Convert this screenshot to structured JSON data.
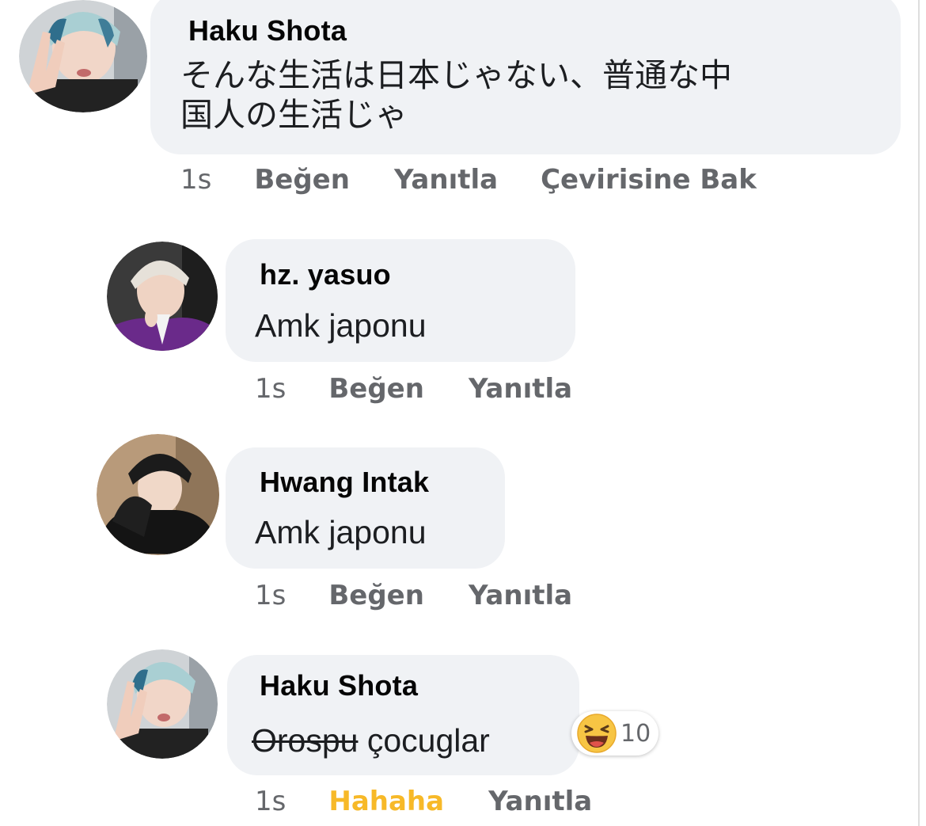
{
  "comments": [
    {
      "author": "Haku  Shota",
      "text_line1": "そんな生活は日本じゃない、普通な中",
      "text_line2": "国人の生活じゃ",
      "time": "1s",
      "like": "Beğen",
      "reply": "Yanıtla",
      "translate": "Çevirisine Bak"
    },
    {
      "author": "hz. yasuo",
      "text": "Amk  japonu",
      "time": "1s",
      "like": "Beğen",
      "reply": "Yanıtla"
    },
    {
      "author": "Hwang  Intak",
      "text": "Amk  japonu",
      "time": "1s",
      "like": "Beğen",
      "reply": "Yanıtla"
    },
    {
      "author": "Haku  Shota",
      "text_struck": "Orospu",
      "text_rest": " çocuglar",
      "time": "1s",
      "reaction_label": "Hahaha",
      "reaction_label_color": "#f7b928",
      "reply": "Yanıtla",
      "reaction": {
        "icon": "laughing-emoji-icon",
        "count": "10"
      }
    }
  ],
  "colors": {
    "bubble": "#f0f2f5",
    "meta_text": "#65676b"
  }
}
